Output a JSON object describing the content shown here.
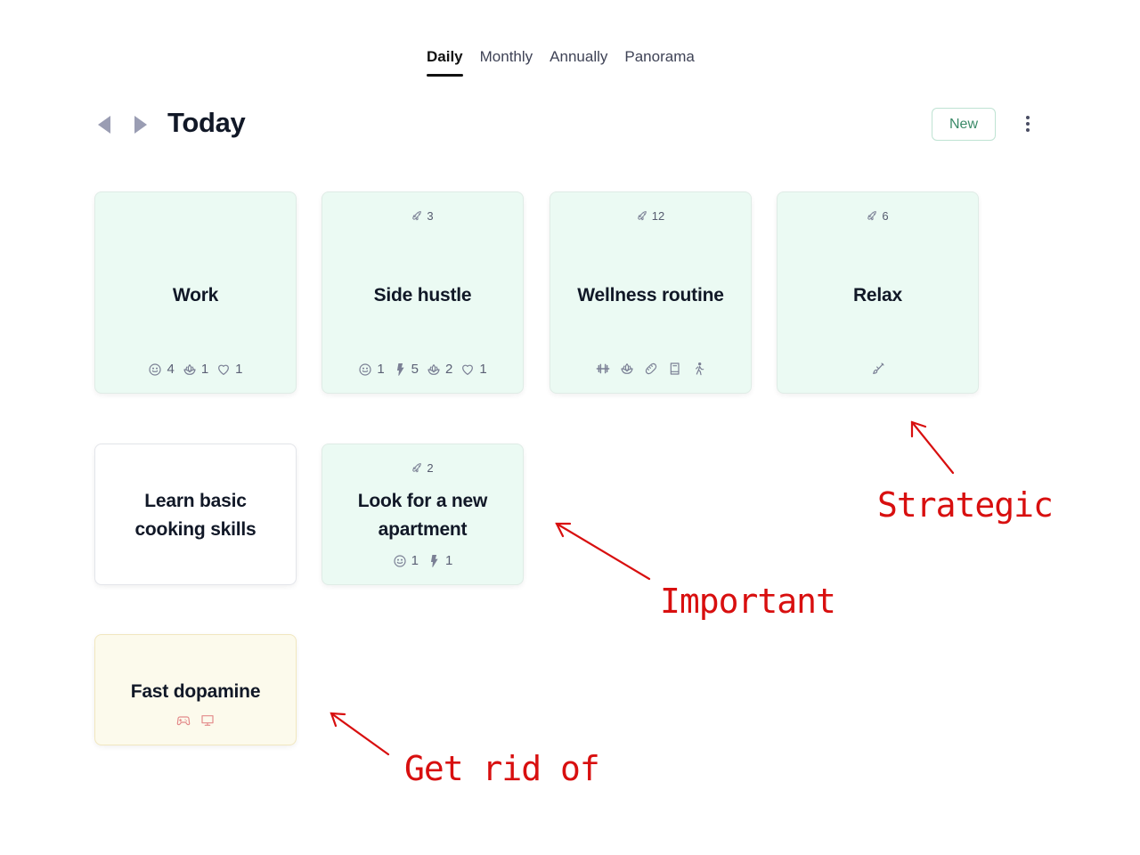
{
  "tabs": [
    {
      "label": "Daily",
      "active": true
    },
    {
      "label": "Monthly",
      "active": false
    },
    {
      "label": "Annually",
      "active": false
    },
    {
      "label": "Panorama",
      "active": false
    }
  ],
  "header": {
    "title": "Today",
    "new_label": "New",
    "prev_icon": "triangle-left-icon",
    "next_icon": "triangle-right-icon",
    "more_icon": "vertical-dots-icon"
  },
  "cards": [
    {
      "title": "Work",
      "color": "green",
      "badge": null,
      "meta": [
        {
          "icon": "smiley-icon",
          "count": "4"
        },
        {
          "icon": "lotus-icon",
          "count": "1"
        },
        {
          "icon": "heart-icon",
          "count": "1"
        }
      ]
    },
    {
      "title": "Side hustle",
      "color": "green",
      "badge": {
        "icon": "rocket-icon",
        "count": "3"
      },
      "meta": [
        {
          "icon": "smiley-icon",
          "count": "1"
        },
        {
          "icon": "lightning-icon",
          "count": "5"
        },
        {
          "icon": "lotus-icon",
          "count": "2"
        },
        {
          "icon": "heart-icon",
          "count": "1"
        }
      ]
    },
    {
      "title": "Wellness routine",
      "color": "green",
      "badge": {
        "icon": "rocket-icon",
        "count": "12"
      },
      "meta": [
        {
          "icon": "dumbbell-icon"
        },
        {
          "icon": "lotus-icon"
        },
        {
          "icon": "bread-icon"
        },
        {
          "icon": "book-icon"
        },
        {
          "icon": "walking-icon"
        }
      ]
    },
    {
      "title": "Relax",
      "color": "green",
      "badge": {
        "icon": "rocket-icon",
        "count": "6"
      },
      "meta": [
        {
          "icon": "paintbrush-icon"
        }
      ]
    },
    {
      "title": "Learn basic cooking skills",
      "title_lines": [
        "Learn basic",
        "cooking skills"
      ],
      "color": "white",
      "badge": null,
      "meta": []
    },
    {
      "title": "Look for a new apartment",
      "title_lines": [
        "Look for a new",
        "apartment"
      ],
      "color": "green",
      "badge": {
        "icon": "rocket-icon",
        "count": "2"
      },
      "meta": [
        {
          "icon": "smiley-icon",
          "count": "1"
        },
        {
          "icon": "lightning-icon",
          "count": "1"
        }
      ]
    },
    {
      "title": "Fast dopamine",
      "color": "yellow",
      "badge": null,
      "meta": [
        {
          "icon": "gamepad-icon"
        },
        {
          "icon": "monitor-icon"
        }
      ]
    }
  ],
  "annotations": {
    "strategic": "Strategic",
    "important": "Important",
    "get_rid_of": "Get rid of",
    "color": "#d80f0f"
  },
  "colors": {
    "accent_green": "#3b8a68",
    "card_green": "#ebfaf3",
    "card_yellow": "#fcfaec",
    "annotation_red": "#d80f0f"
  }
}
